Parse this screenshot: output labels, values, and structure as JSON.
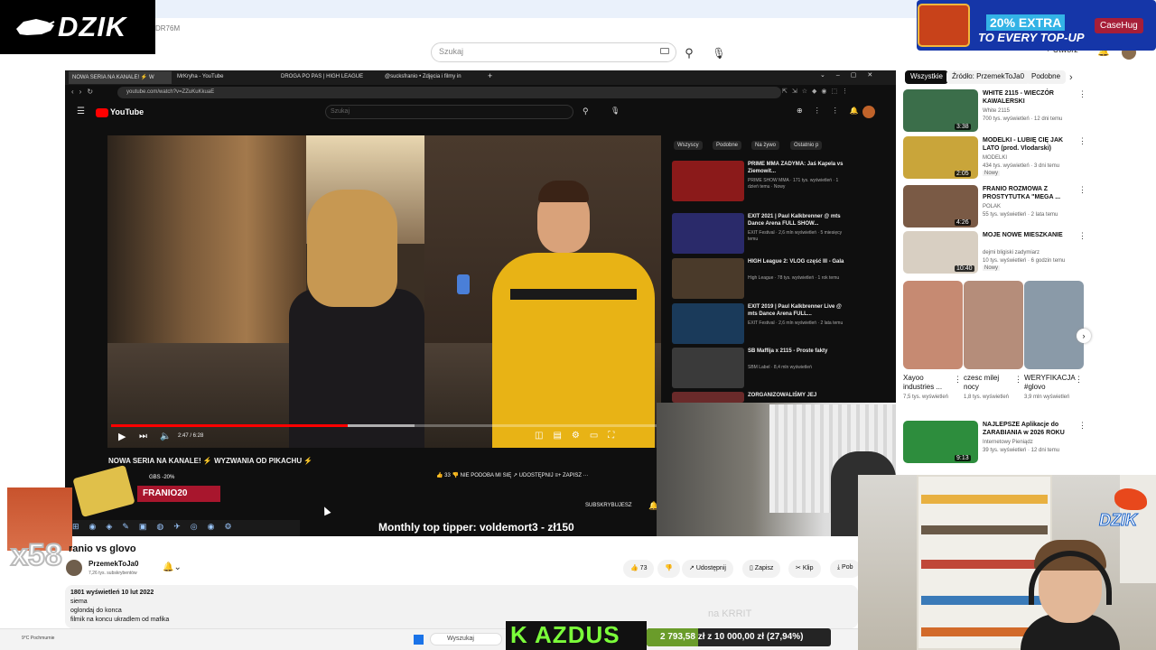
{
  "header": {
    "top_small_text": "DR76M",
    "search_placeholder": "Szukaj",
    "create_label": "+ Utwórz",
    "notif_count": "3"
  },
  "logo": {
    "brand": "DZIK"
  },
  "promo": {
    "line1": "20% EXTRA",
    "line2": "TO EVERY TOP-UP",
    "brand": "CaseHug"
  },
  "filters": {
    "all": "Wszystkie",
    "source": "Źródło: PrzemekToJa0",
    "similar": "Podobne"
  },
  "related": [
    {
      "title": "WHITE 2115 - WIECZÓR KAWALERSKI",
      "channel": "White 2115",
      "stats": "700 tys. wyświetleń · 12 dni temu",
      "duration": "3:38",
      "new": "",
      "thumb_color": "#3b6e4a"
    },
    {
      "title": "MODELKI - LUBIĘ CIĘ JAK LATO (prod. Vlodarski)",
      "channel": "MODELKI",
      "stats": "434 tys. wyświetleń · 3 dni temu",
      "duration": "2:05",
      "new": "Nowy",
      "thumb_color": "#c9a53a"
    },
    {
      "title": "FRANIO ROZMOWA Z PROSTYTUTKA \"MEGA ...",
      "channel": "POLAK",
      "stats": "55 tys. wyświetleń · 2 lata temu",
      "duration": "4:26",
      "new": "",
      "thumb_color": "#7a5a45"
    },
    {
      "title": "MOJE NOWE MIESZKANIE",
      "channel": "dejmi bligiski zadymiarz",
      "stats": "10 tys. wyświetleń · 6 godzin temu",
      "duration": "10:40",
      "new": "Nowy",
      "thumb_color": "#d8cfc2"
    },
    {
      "title": "NAJLEPSZE Aplikacje do ZARABIANIA w 2026 ROKU",
      "channel": "Internetowy Pieniądz",
      "stats": "39 tys. wyświetleń · 12 dni temu",
      "duration": "9:13",
      "new": "",
      "thumb_color": "#2d8d3d"
    }
  ],
  "shorts": [
    {
      "title": "Xayoo industries ...",
      "views": "7,5 tys. wyświetleń",
      "thumb_color": "#c68a72"
    },
    {
      "title": "czesc milej nocy",
      "views": "1,8 tys. wyświetleń",
      "thumb_color": "#b58d7a"
    },
    {
      "title": "WERYFIKACJA #glovo",
      "views": "3,9 mln wyświetleń",
      "thumb_color": "#8a9aa8"
    }
  ],
  "inner_browser": {
    "tabs": [
      "NOWA SERIA NA KANALE! ⚡ W",
      "MrKryha - YouTube",
      "DROGA PO PAS | HIGH LEAGUE",
      "@sucksfranio • Zdjęcia i filmy in"
    ],
    "address": "youtube.com/watch?v=ZZuKuKkuaE",
    "search_placeholder": "Szukaj",
    "yt_text": "YouTube",
    "chips": [
      "Wszyscy",
      "Podobne",
      "Na żywo",
      "Ostatnio p"
    ],
    "video_time": "2:47 / 6:28",
    "video_title": "NOWA SERIA NA KANALE! ⚡ WYZWANIA OD PIKACHU ⚡",
    "actions": "👍 33   👎 NIE PODOBA MI SIĘ   ↗ UDOSTĘPNIJ   ≡+ ZAPISZ   ···",
    "subscribe": "SUBSKRYBUJESZ",
    "promo_code": "FRANIO20",
    "promo_tag": "GBS  -20%",
    "list": [
      {
        "title": "PRIME MMA ZADYMA: Jaś Kapela vs Ziemowit...",
        "meta": "PRIME SHOW MMA · 171 tys. wyświetleń · 1 dzień temu · Nowy",
        "thumb_color": "#8b1a1a"
      },
      {
        "title": "EXIT 2021 | Paul Kalkbrenner @ mts Dance Arena FULL SHOW...",
        "meta": "EXIT Festival · 2,6 mln wyświetleń · 5 miesięcy temu",
        "thumb_color": "#2a2a6a"
      },
      {
        "title": "HIGH League 2: VLOG część III - Gala",
        "meta": "High League · 78 tys. wyświetleń · 1 rok temu",
        "thumb_color": "#4a3a2a"
      },
      {
        "title": "EXIT 2019 | Paul Kalkbrenner Live @ mts Dance Arena FULL...",
        "meta": "EXIT Festival · 2,6 mln wyświetleń · 2 lata temu",
        "thumb_color": "#1a3a5a"
      },
      {
        "title": "SB Maffija x 2115 - Proste fakty",
        "meta": "SBM Label · 8,4 mln wyświetleń",
        "thumb_color": "#3a3a3a"
      },
      {
        "title": "ZORGANIZOWALIŚMY JEJ",
        "meta": "",
        "thumb_color": "#6a2a2a"
      }
    ]
  },
  "tipper": "Monthly top tipper: voldemort3 - zł150",
  "overlay": {
    "x_count": "x58"
  },
  "video": {
    "title": "ranio vs glovo",
    "channel": "PrzemekToJa0",
    "subs": "7,26 tys. subskrybentów",
    "likes": "73",
    "share": "Udostępnij",
    "save": "Zapisz",
    "clip": "Klip",
    "download": "Pob",
    "meta": "1801 wyświetleń  10 lut 2022",
    "desc": [
      "siema",
      "oglondaj do konca",
      "filmik na koncu ukradlem od mafika"
    ]
  },
  "taskbar": {
    "weather": "9°C Pochmurnie",
    "search": "Wyszukaj"
  },
  "alert": {
    "text": "K AZDUS",
    "goal": "2 793,58 zł z 10 000,00 zł (27,94%)",
    "goal_fraction": 0.2794,
    "watermark": "na KRRIT"
  },
  "cam": {
    "brand": "DZIK"
  }
}
